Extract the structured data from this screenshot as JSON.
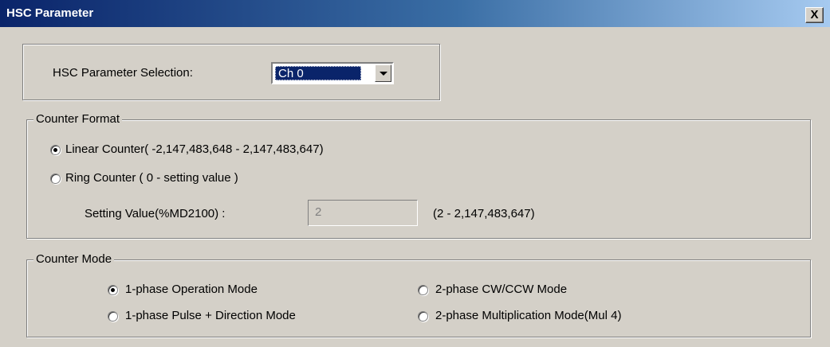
{
  "window": {
    "title": "HSC Parameter",
    "close_label": "X"
  },
  "selection": {
    "label": "HSC Parameter Selection:",
    "value": "Ch 0"
  },
  "counter_format": {
    "legend": "Counter Format",
    "linear_label": "Linear Counter( -2,147,483,648 - 2,147,483,647)",
    "ring_label": "Ring Counter ( 0 - setting value )",
    "setting_label": "Setting Value(%MD2100) :",
    "setting_value": "2",
    "range_label": "(2 - 2,147,483,647)",
    "selected": "linear"
  },
  "counter_mode": {
    "legend": "Counter Mode",
    "options": [
      "1-phase Operation Mode",
      "1-phase Pulse + Direction Mode",
      "2-phase CW/CCW Mode",
      "2-phase Multiplication Mode(Mul 4)"
    ],
    "selected": "1-phase Operation Mode"
  }
}
